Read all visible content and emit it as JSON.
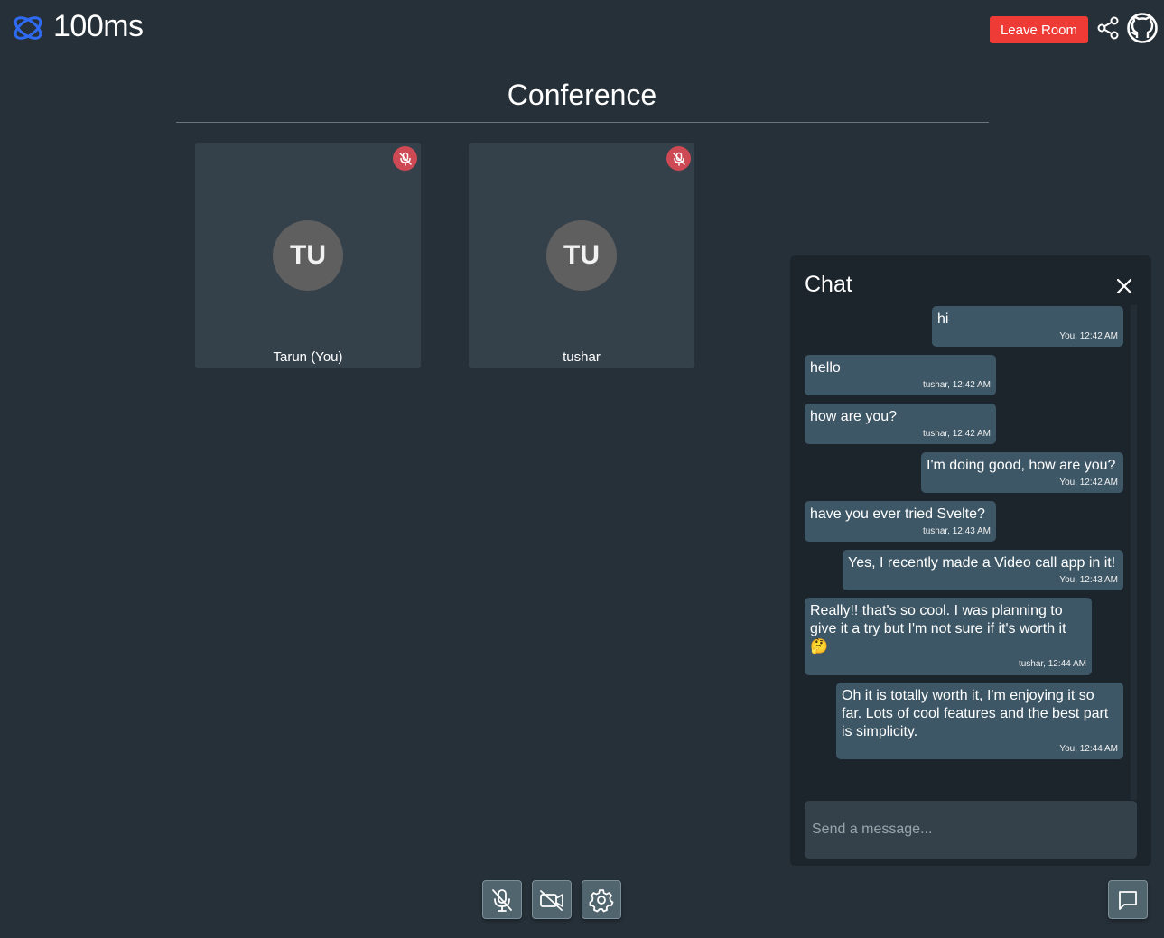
{
  "header": {
    "brand": "100ms",
    "leave_label": "Leave Room",
    "brand_color": "#2f6bf2",
    "leave_color": "#ef3b36"
  },
  "conference": {
    "title": "Conference"
  },
  "tiles": [
    {
      "initials": "TU",
      "name": "Tarun (You)",
      "muted": true
    },
    {
      "initials": "TU",
      "name": "tushar",
      "muted": true
    }
  ],
  "chat": {
    "title": "Chat",
    "placeholder": "Send a message...",
    "messages": [
      {
        "text": "hi",
        "meta": "You, 12:42 AM",
        "mine": true
      },
      {
        "text": "hello",
        "meta": "tushar, 12:42 AM",
        "mine": false
      },
      {
        "text": "how are you?",
        "meta": "tushar, 12:42 AM",
        "mine": false
      },
      {
        "text": "I'm doing good, how are you?",
        "meta": "You, 12:42 AM",
        "mine": true
      },
      {
        "text": "have you ever tried Svelte?",
        "meta": "tushar, 12:43 AM",
        "mine": false
      },
      {
        "text": "Yes, I recently made a Video call app in it!",
        "meta": "You, 12:43 AM",
        "mine": true
      },
      {
        "text": "Really!! that's so cool. I was planning to give it a try but I'm not sure if it's worth it 🤔",
        "meta": "tushar, 12:44 AM",
        "mine": false
      },
      {
        "text": "Oh it is totally worth it, I'm enjoying it so far. Lots of cool features and the best part is simplicity.",
        "meta": "You, 12:44 AM",
        "mine": true
      }
    ]
  },
  "controls": {
    "icons": [
      "mic-off-icon",
      "camera-off-icon",
      "gear-icon",
      "chat-icon"
    ],
    "mute_badge_color": "#cd4953"
  }
}
